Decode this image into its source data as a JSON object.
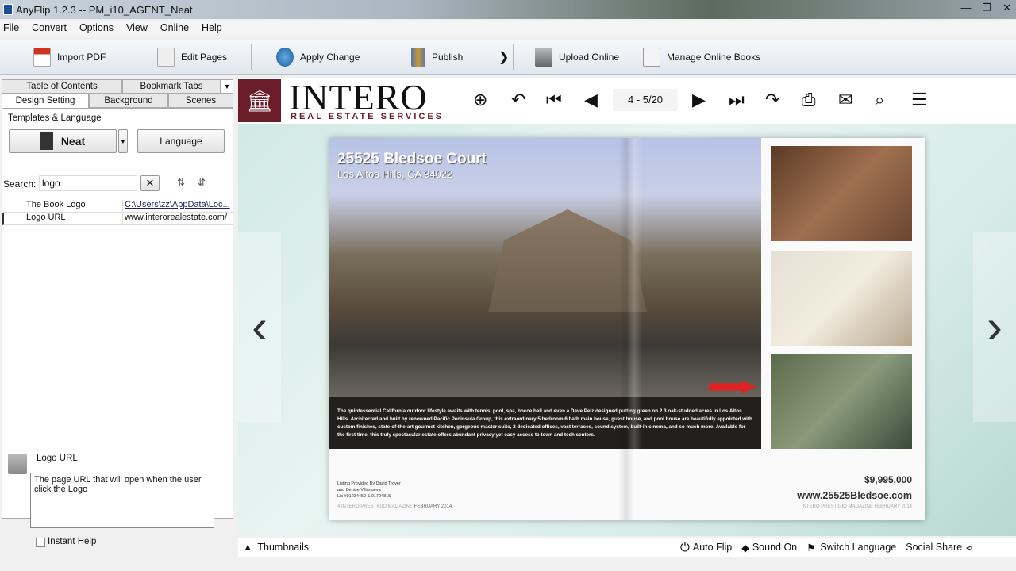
{
  "window": {
    "title": "AnyFlip 1.2.3  -- PM_i10_AGENT_Neat",
    "min": "—",
    "max": "❐",
    "close": "✕"
  },
  "menu": [
    "File",
    "Convert",
    "Options",
    "View",
    "Online",
    "Help"
  ],
  "toolbar": {
    "import_pdf": "Import PDF",
    "edit_pages": "Edit Pages",
    "apply_change": "Apply Change",
    "publish": "Publish",
    "more": "❯",
    "upload_online": "Upload Online",
    "manage_online_books": "Manage Online Books"
  },
  "left": {
    "tabs_top": [
      "Table of Contents",
      "Bookmark Tabs"
    ],
    "tabs_bottom": [
      "Design Setting",
      "Background",
      "Scenes"
    ],
    "section": "Templates & Language",
    "template": "Neat",
    "language_btn": "Language",
    "search_label": "Search:",
    "search_value": "logo",
    "props": [
      {
        "name": "The Book Logo",
        "value": "C:\\Users\\zz\\AppData\\Loc..."
      },
      {
        "name": "Logo URL",
        "value": "www.interorealestate.com/"
      }
    ],
    "help_title": "Logo URL",
    "help_text": "The page URL that will open when the user click the Logo",
    "instant_help": "Instant Help"
  },
  "viewer": {
    "logo_main": "INTERO",
    "logo_sub": "REAL ESTATE SERVICES",
    "page_indicator": "4 - 5/20",
    "book": {
      "title": "25525 Bledsoe Court",
      "subtitle": "Los Altos Hills, CA 94022",
      "description": "The quintessential California outdoor lifestyle awaits with tennis, pool, spa, bocce ball and even a Dave Pelz designed putting green on 2.3 oak-studded acres in Los Altos Hills. Architected and built by renowned Pacific Peninsula Group, this extraordinary 5 bedroom 6 bath main house, guest house, and pool house are beautifully appointed with custom finishes, state-of-the-art gourmet kitchen, gorgeous master suite, 2 dedicated offices, vast terraces, sound system, built-in cinema, and so much more. Available for the first time, this truly spectacular estate offers abundant privacy yet easy access to town and tech centers.",
      "listing": [
        "Listing Provided By David Troyer",
        "and Denise Villanueva",
        "Lic #01234450 & 01794815"
      ],
      "footer_left": "4  INTERO PRESTIGIO MAGAZINE",
      "footer_left_date": "FEBRUARY 2014",
      "price": "$9,995,000",
      "website": "www.25525Bledsoe.com",
      "footer_right": "INTERO PRESTIGIO MAGAZINE FEBRUARY 2014"
    }
  },
  "bottom": {
    "thumbnails": "Thumbnails",
    "auto_flip": "Auto Flip",
    "sound_on": "Sound On",
    "switch_language": "Switch Language",
    "social_share": "Social Share"
  }
}
